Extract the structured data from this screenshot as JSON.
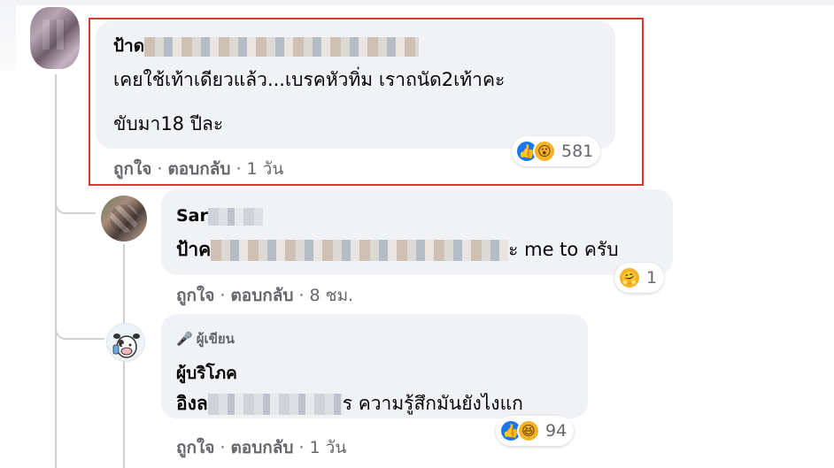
{
  "comments": [
    {
      "name_visible": "ป้าด",
      "text_line1": "เคยใช้เท้าเดียวแล้ว...เบรคหัวทิ่ม เราถนัด2เท้าคะ",
      "text_line2": "ขับมา18 ปีละ",
      "like_label": "ถูกใจ",
      "reply_label": "ตอบกลับ",
      "time": "1 วัน",
      "reactions": [
        "like-icon",
        "wow-icon"
      ],
      "reaction_count": "581"
    },
    {
      "name_visible": "Sar",
      "text_prefix": "ป้าค",
      "text_suffix": "ะ me to ครับ",
      "like_label": "ถูกใจ",
      "reply_label": "ตอบกลับ",
      "time": "8 ชม.",
      "reactions": [
        "care-icon"
      ],
      "reaction_count": "1"
    },
    {
      "author_badge": "ผู้เขียน",
      "name": "ผู้บริโภค",
      "text_prefix": "อิงล",
      "text_suffix": "ร ความรู้สึกมันยังไงแก",
      "like_label": "ถูกใจ",
      "reply_label": "ตอบกลับ",
      "time": "1 วัน",
      "reactions": [
        "like-icon",
        "haha-icon"
      ],
      "reaction_count": "94"
    }
  ],
  "colors": {
    "bubble": "#f0f2f5",
    "secondary_text": "#65676b",
    "like_blue": "#1877f2",
    "highlight": "#e03535"
  }
}
